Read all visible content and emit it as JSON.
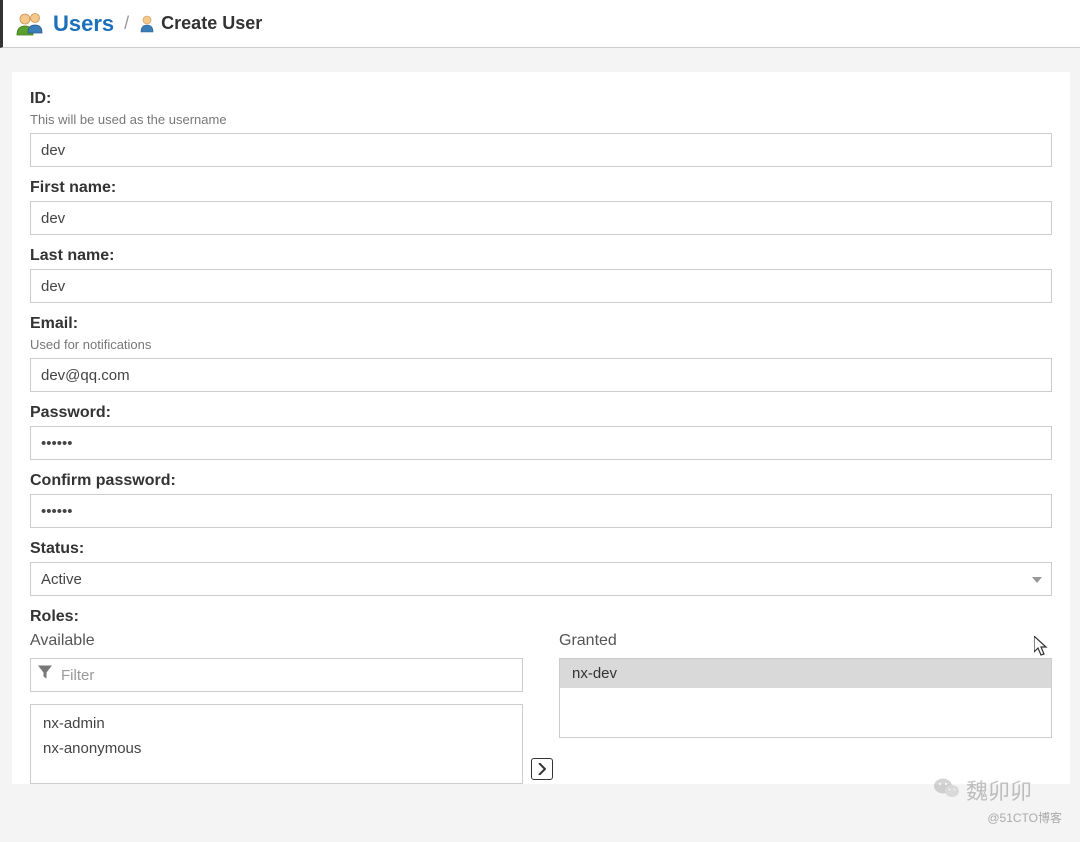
{
  "breadcrumb": {
    "root": "Users",
    "current": "Create User"
  },
  "form": {
    "id": {
      "label": "ID:",
      "hint": "This will be used as the username",
      "value": "dev"
    },
    "first_name": {
      "label": "First name:",
      "value": "dev"
    },
    "last_name": {
      "label": "Last name:",
      "value": "dev"
    },
    "email": {
      "label": "Email:",
      "hint": "Used for notifications",
      "value": "dev@qq.com"
    },
    "password": {
      "label": "Password:",
      "value": "••••••"
    },
    "confirm_password": {
      "label": "Confirm password:",
      "value": "••••••"
    },
    "status": {
      "label": "Status:",
      "value": "Active"
    },
    "roles": {
      "label": "Roles:",
      "available_label": "Available",
      "granted_label": "Granted",
      "filter_placeholder": "Filter",
      "available": [
        "nx-admin",
        "nx-anonymous"
      ],
      "granted": [
        "nx-dev"
      ]
    }
  },
  "watermark": {
    "name": "魏卯卯",
    "source": "@51CTO博客"
  }
}
